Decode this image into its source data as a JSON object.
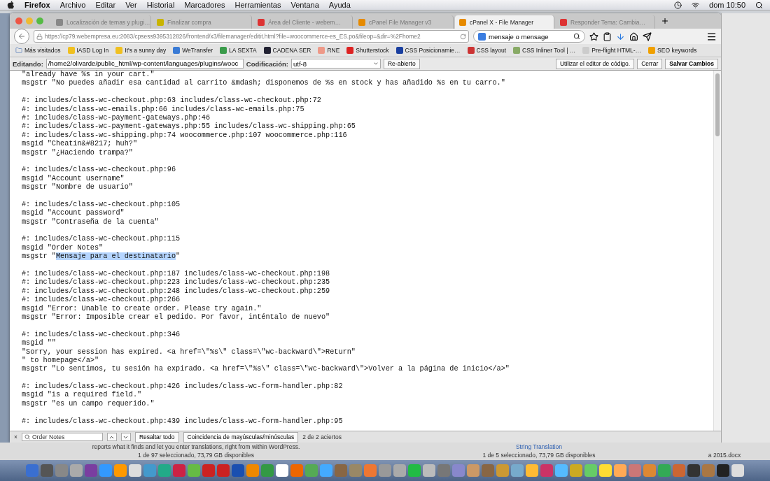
{
  "menubar": {
    "app": "Firefox",
    "menus": [
      "Archivo",
      "Editar",
      "Ver",
      "Historial",
      "Marcadores",
      "Herramientas",
      "Ventana",
      "Ayuda"
    ],
    "clock": "dom 10:50"
  },
  "tabs": [
    {
      "label": "Localización de temas y plugi…",
      "selected": false
    },
    {
      "label": "Finalizar compra",
      "selected": false
    },
    {
      "label": "Área del Cliente - webem…",
      "selected": false
    },
    {
      "label": "cPanel File Manager v3",
      "selected": false
    },
    {
      "label": "cPanel X - File Manager",
      "selected": true
    },
    {
      "label": "Responder Tema: Cambia…",
      "selected": false
    }
  ],
  "address": {
    "url": "https://cp79.webempresa.eu:2083/cpsess9395312826/frontend/x3/filemanager/editit.html?file=woocommerce-es_ES.po&fileop=&dir=%2Fhome2"
  },
  "search": {
    "value": "mensaje o mensage"
  },
  "bookmarks": [
    "Más visitados",
    "IASD Log In",
    "It's a sunny day",
    "WeTransfer",
    "LA SEXTA",
    "CADENA SER",
    "RNE",
    "Shutterstock",
    "CSS Posicionamie…",
    "CSS  layout",
    "CSS Inliner Tool | …",
    "Pre-flight HTML-…",
    "SEO keywords"
  ],
  "editor": {
    "editing_label": "Editando:",
    "path": "/home2/olivarde/public_html/wp-content/languages/plugins/wooc",
    "encoding_label": "Codificación:",
    "encoding": "utf-8",
    "buttons": [
      "Re-abierto",
      "Utilizar el editor de código.",
      "Cerrar",
      "Salvar Cambios"
    ]
  },
  "code_blocks": [
    [
      {
        "text": "\"already have %s in your cart.\""
      },
      {
        "text": "msgstr \"No puedes añadir esa cantidad al carrito &mdash; disponemos de %s en stock y has añadido %s en tu carro.\""
      }
    ],
    [
      {
        "text": "#: includes/class-wc-checkout.php:63 includes/class-wc-checkout.php:72"
      },
      {
        "text": "#: includes/class-wc-emails.php:66 includes/class-wc-emails.php:75"
      },
      {
        "text": "#: includes/class-wc-payment-gateways.php:46"
      },
      {
        "text": "#: includes/class-wc-payment-gateways.php:55 includes/class-wc-shipping.php:65"
      },
      {
        "text": "#: includes/class-wc-shipping.php:74 woocommerce.php:107 woocommerce.php:116"
      },
      {
        "text": "msgid \"Cheatin&#8217; huh?\""
      },
      {
        "text": "msgstr \"¿Haciendo trampa?\""
      }
    ],
    [
      {
        "text": "#: includes/class-wc-checkout.php:96"
      },
      {
        "text": "msgid \"Account username\""
      },
      {
        "text": "msgstr \"Nombre de usuario\""
      }
    ],
    [
      {
        "text": "#: includes/class-wc-checkout.php:105"
      },
      {
        "text": "msgid \"Account password\""
      },
      {
        "text": "msgstr \"Contraseña de la cuenta\""
      }
    ],
    [
      {
        "text": "#: includes/class-wc-checkout.php:115"
      },
      {
        "text": "msgid \"Order Notes\""
      },
      {
        "text": "msgstr \"",
        "selected": "Mensaje para el destinatario",
        "after": "\""
      }
    ],
    [
      {
        "text": "#: includes/class-wc-checkout.php:187 includes/class-wc-checkout.php:198"
      },
      {
        "text": "#: includes/class-wc-checkout.php:223 includes/class-wc-checkout.php:235"
      },
      {
        "text": "#: includes/class-wc-checkout.php:248 includes/class-wc-checkout.php:259"
      },
      {
        "text": "#: includes/class-wc-checkout.php:266"
      },
      {
        "text": "msgid \"Error: Unable to create order. Please try again.\""
      },
      {
        "text": "msgstr \"Error: Imposible crear el pedido. Por favor, inténtalo de nuevo\""
      }
    ],
    [
      {
        "text": "#: includes/class-wc-checkout.php:346"
      },
      {
        "text": "msgid \"\""
      },
      {
        "text": "\"Sorry, your session has expired. <a href=\\\"%s\\\" class=\\\"wc-backward\\\">Return\""
      },
      {
        "text": "\" to homepage</a>\""
      },
      {
        "text": "msgstr \"Lo sentimos, tu sesión ha expirado. <a href=\\\"%s\\\" class=\\\"wc-backward\\\">Volver a la página de inicio</a>\""
      }
    ],
    [
      {
        "text": "#: includes/class-wc-checkout.php:426 includes/class-wc-form-handler.php:82"
      },
      {
        "text": "msgid \"is a required field.\""
      },
      {
        "text": "msgstr \"es un campo requerido.\""
      }
    ],
    [
      {
        "text": "#: includes/class-wc-checkout.php:439 includes/class-wc-form-handler.php:95"
      }
    ]
  ],
  "findbar": {
    "close": "×",
    "query": "Order Notes",
    "buttons": [
      "Resaltar todo",
      "Coincidencia de mayúsculas/minúsculas"
    ],
    "result": "2 de 2 aciertos"
  },
  "background": {
    "text": "reports what it finds and let you enter translations, right from within WordPress.",
    "status_left": "1 de 97 seleccionado, 73,79 GB disponibles",
    "link": "String Translation",
    "status_right": "1 de 5 seleccionado, 73,79 GB disponibles",
    "file": "a 2015.docx"
  }
}
